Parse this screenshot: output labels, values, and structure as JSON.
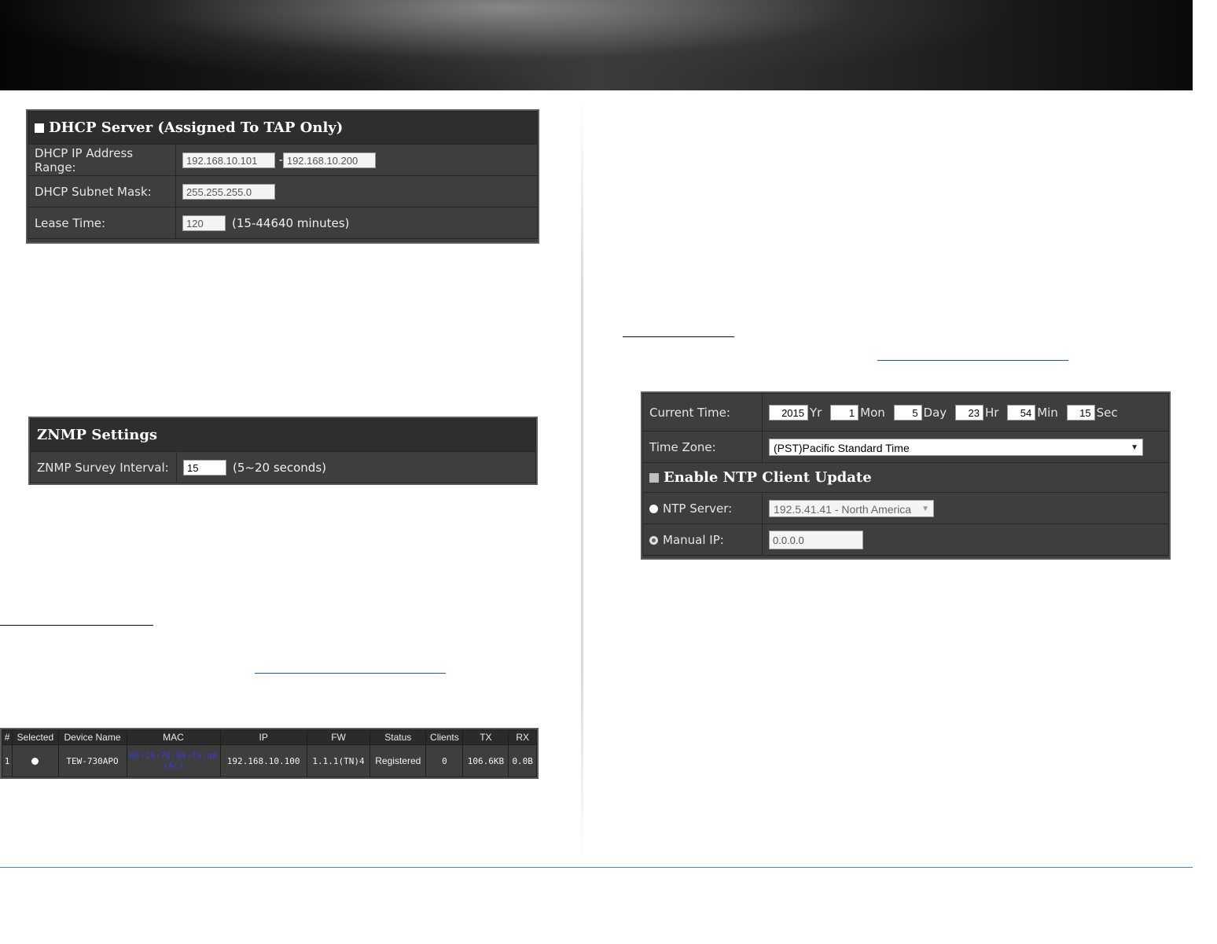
{
  "dhcp": {
    "title": "DHCP Server (Assigned To TAP Only)",
    "range_label": "DHCP IP Address Range:",
    "range_start": "192.168.10.101",
    "range_dash": "-",
    "range_end": "192.168.10.200",
    "mask_label": "DHCP Subnet Mask:",
    "mask_value": "255.255.255.0",
    "lease_label": "Lease Time:",
    "lease_value": "120",
    "lease_hint": "(15-44640 minutes)"
  },
  "znmp": {
    "title": "ZNMP Settings",
    "interval_label": "ZNMP Survey Interval:",
    "interval_value": "15",
    "interval_hint": "(5~20 seconds)"
  },
  "devices": {
    "headers": [
      "#",
      "Selected",
      "Device Name",
      "MAC",
      "IP",
      "FW",
      "Status",
      "Clients",
      "TX",
      "RX"
    ],
    "row": {
      "num": "1",
      "name": "TEW-730APO",
      "mac": "00:19:70:94:fe:a6",
      "mac_band": "(AC)",
      "ip": "192.168.10.100",
      "fw": "1.1.1(TN)4",
      "status": "Registered",
      "clients": "0",
      "tx": "106.6KB",
      "rx": "0.0B"
    }
  },
  "time": {
    "current_label": "Current Time:",
    "year": "2015",
    "year_unit": "Yr",
    "month": "1",
    "month_unit": "Mon",
    "day": "5",
    "day_unit": "Day",
    "hour": "23",
    "hour_unit": "Hr",
    "minute": "54",
    "minute_unit": "Min",
    "second": "15",
    "second_unit": "Sec",
    "zone_label": "Time Zone:",
    "zone_value": "(PST)Pacific Standard Time",
    "ntp_title": "Enable NTP Client Update",
    "ntp_server_label": "NTP Server:",
    "ntp_server_value": "192.5.41.41 - North America",
    "manual_ip_label": "Manual IP:",
    "manual_ip_value": "0.0.0.0"
  }
}
